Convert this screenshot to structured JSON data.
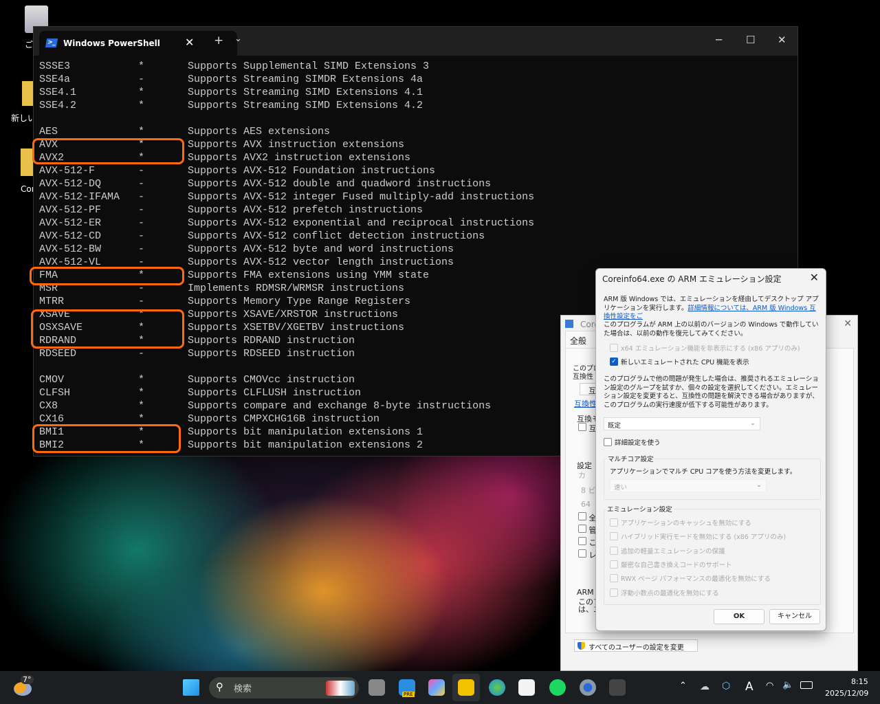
{
  "desktop": {
    "icons": [
      "ご",
      "新しい",
      "Cor"
    ]
  },
  "terminal": {
    "tab_title": "Windows PowerShell",
    "new_tab": "+",
    "dropdown": "⌄",
    "minimize": "─",
    "maximize": "☐",
    "close": "✕",
    "rows": [
      [
        "SSSE3",
        "*",
        "Supports Supplemental SIMD Extensions 3"
      ],
      [
        "SSE4a",
        "-",
        "Supports Streaming SIMDR Extensions 4a"
      ],
      [
        "SSE4.1",
        "*",
        "Supports Streaming SIMD Extensions 4.1"
      ],
      [
        "SSE4.2",
        "*",
        "Supports Streaming SIMD Extensions 4.2"
      ],
      [
        "",
        "",
        ""
      ],
      [
        "AES",
        "*",
        "Supports AES extensions"
      ],
      [
        "AVX",
        "*",
        "Supports AVX instruction extensions"
      ],
      [
        "AVX2",
        "*",
        "Supports AVX2 instruction extensions"
      ],
      [
        "AVX-512-F",
        "-",
        "Supports AVX-512 Foundation instructions"
      ],
      [
        "AVX-512-DQ",
        "-",
        "Supports AVX-512 double and quadword instructions"
      ],
      [
        "AVX-512-IFAMA",
        "-",
        "Supports AVX-512 integer Fused multiply-add instructions"
      ],
      [
        "AVX-512-PF",
        "-",
        "Supports AVX-512 prefetch instructions"
      ],
      [
        "AVX-512-ER",
        "-",
        "Supports AVX-512 exponential and reciprocal instructions"
      ],
      [
        "AVX-512-CD",
        "-",
        "Supports AVX-512 conflict detection instructions"
      ],
      [
        "AVX-512-BW",
        "-",
        "Supports AVX-512 byte and word instructions"
      ],
      [
        "AVX-512-VL",
        "-",
        "Supports AVX-512 vector length instructions"
      ],
      [
        "FMA",
        "*",
        "Supports FMA extensions using YMM state"
      ],
      [
        "MSR",
        "-",
        "Implements RDMSR/WRMSR instructions"
      ],
      [
        "MTRR",
        "-",
        "Supports Memory Type Range Registers"
      ],
      [
        "XSAVE",
        "*",
        "Supports XSAVE/XRSTOR instructions"
      ],
      [
        "OSXSAVE",
        "*",
        "Supports XSETBV/XGETBV instructions"
      ],
      [
        "RDRAND",
        "*",
        "Supports RDRAND instruction"
      ],
      [
        "RDSEED",
        "-",
        "Supports RDSEED instruction"
      ],
      [
        "",
        "",
        ""
      ],
      [
        "CMOV",
        "*",
        "Supports CMOVcc instruction"
      ],
      [
        "CLFSH",
        "*",
        "Supports CLFLUSH instruction"
      ],
      [
        "CX8",
        "*",
        "Supports compare and exchange 8-byte instructions"
      ],
      [
        "CX16",
        "*",
        "Supports CMPXCHG16B instruction"
      ],
      [
        "BMI1",
        "*",
        "Supports bit manipulation extensions 1"
      ],
      [
        "BMI2",
        "*",
        "Supports bit manipulation extensions 2"
      ]
    ],
    "highlight_color": "#ff6a0f"
  },
  "properties": {
    "title": "Core",
    "tab": "全般",
    "frag": [
      "このプロ",
      "互換性",
      "互",
      "互換性",
      "互換モ",
      "互",
      "設定",
      "カ",
      "8 ビッ",
      "64",
      "全",
      "管",
      "この",
      "レ",
      "ARM 版",
      "このプ",
      "は、エ"
    ],
    "all_users_button": "すべてのユーザーの設定を変更"
  },
  "dialog": {
    "title": "Coreinfo64.exe の ARM エミュレーション設定",
    "close": "✕",
    "intro": "ARM 版 Windows では、エミュレーションを経由してデスクトップ アプリケーションを実行します。",
    "link": "詳細情報については、ARM 版 Windows 互換性設定をご",
    "prev_text": "このプログラムが ARM 上の以前のバージョンの Windows で動作していた場合は、以前の動作を復元してみてください。",
    "cb_hide_x64": "x64 エミュレーション機能を非表示にする (x86 アプリのみ)",
    "cb_new_cpu": "新しいエミュレートされた CPU 機能を表示",
    "problem_text": "このプログラムで他の問題が発生した場合は、推奨されるエミュレーション設定のグループを試すか、個々の設定を選択してください。エミュレーション設定を変更すると、互換性の問題を解決できる場合がありますが、このプログラムの実行速度が低下する可能性があります。",
    "preset": "既定",
    "cb_advanced": "詳細設定を使う",
    "multicore_title": "マルチコア設定",
    "multicore_desc": "アプリケーションでマルチ CPU コアを使う方法を変更します。",
    "multicore_value": "速い",
    "emu_title": "エミュレーション設定",
    "emu_options": [
      "アプリケーションのキャッシュを無効にする",
      "ハイブリッド実行モードを無効にする (x86 アプリのみ)",
      "追加の軽量エミュレーションの保護",
      "厳密な自己書き換えコードのサポート",
      "RWX ページ パフォーマンスの最適化を無効にする",
      "浮動小数点の最適化を無効にする"
    ],
    "ok": "OK",
    "cancel": "キャンセル"
  },
  "taskbar": {
    "weather_temp": "7°",
    "search_placeholder": "検索",
    "time": "8:15",
    "date": "2025/12/09",
    "pre_badge": "PRE",
    "ime": "A"
  }
}
